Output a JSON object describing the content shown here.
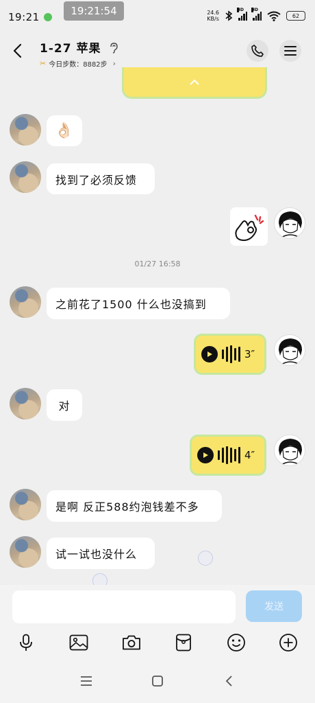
{
  "status": {
    "time": "19:21",
    "timer": "19:21:54",
    "speed_value": "24.6",
    "speed_unit": "KB/s",
    "sig1_label": "HD",
    "sig2_label": "HD",
    "battery": "62"
  },
  "header": {
    "title": "1-27 苹果",
    "steps_text": "今日步数：8882步"
  },
  "messages": [
    {
      "side": "left",
      "text": "👌🏻"
    },
    {
      "side": "left",
      "text": "找到了必须反馈"
    },
    {
      "side": "right",
      "sticker": "ok-hand-sticker"
    },
    {
      "timestamp": "01/27  16:58"
    },
    {
      "side": "left",
      "text": "之前花了1500 什么也没搞到"
    },
    {
      "side": "right",
      "voice": "3″"
    },
    {
      "side": "left",
      "text": "对"
    },
    {
      "side": "right",
      "voice": "4″"
    },
    {
      "side": "left",
      "text": "是啊 反正588约泡钱差不多"
    },
    {
      "side": "left",
      "text": "试一试也没什么"
    }
  ],
  "input": {
    "value": "",
    "send_label": "发送"
  },
  "colors": {
    "background": "#efefef",
    "voice_bubble": "#f8e46b",
    "voice_border": "#c5e89f",
    "send_button": "#a9d3f5"
  }
}
